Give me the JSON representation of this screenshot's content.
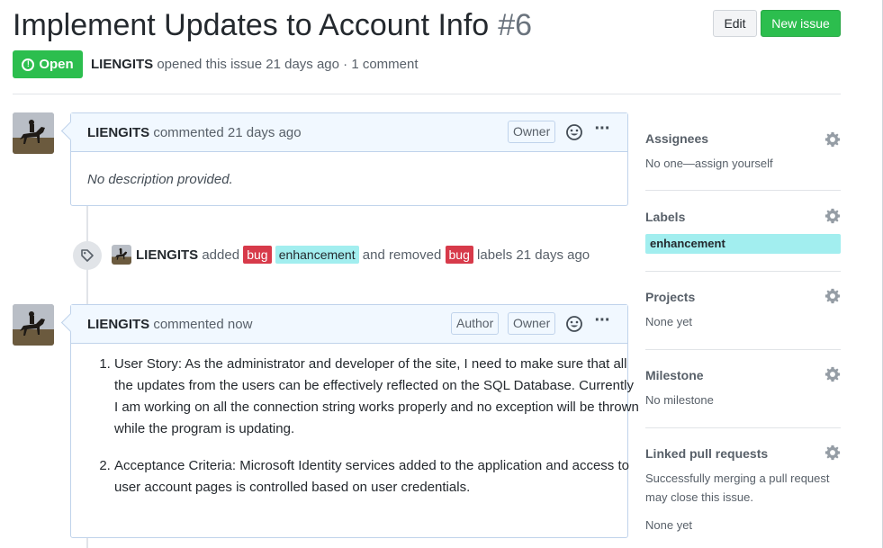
{
  "issue": {
    "title": "Implement Updates to Account Info",
    "number": "#6",
    "state": "Open",
    "author": "LIENGITS",
    "meta_text": "opened this issue 21 days ago · 1 comment"
  },
  "header_buttons": {
    "edit": "Edit",
    "new_issue": "New issue"
  },
  "comments": [
    {
      "author": "LIENGITS",
      "action": "commented 21 days ago",
      "badges": [
        "Owner"
      ],
      "body": "No description provided."
    },
    {
      "author": "LIENGITS",
      "action": "commented now",
      "badges": [
        "Author",
        "Owner"
      ],
      "items": [
        "User Story: As the administrator and developer of the site, I need to make sure that all the updates from the users can be effectively reflected on the SQL Database. Currently I am working on all the connection string works properly and no exception will be thrown while the program is updating.",
        "Acceptance Criteria: Microsoft Identity services added to the application and access to user account pages is controlled based on user credentials."
      ]
    }
  ],
  "event": {
    "actor": "LIENGITS",
    "added": "added",
    "label1": "bug",
    "label2": "enhancement",
    "removed": "and removed",
    "label3": "bug",
    "suffix": "labels 21 days ago"
  },
  "sidebar": {
    "assignees": {
      "title": "Assignees",
      "value": "No one—assign yourself"
    },
    "labels": {
      "title": "Labels",
      "value": "enhancement"
    },
    "projects": {
      "title": "Projects",
      "value": "None yet"
    },
    "milestone": {
      "title": "Milestone",
      "value": "No milestone"
    },
    "linked": {
      "title": "Linked pull requests",
      "hint": "Successfully merging a pull request may close this issue.",
      "value": "None yet"
    }
  },
  "colors": {
    "open_green": "#2cbe4e",
    "bug_label": "#d73a4a",
    "enhancement_label": "#a2eeef",
    "comment_border": "#c0d3eb",
    "comment_header_bg": "#f1f8ff"
  }
}
